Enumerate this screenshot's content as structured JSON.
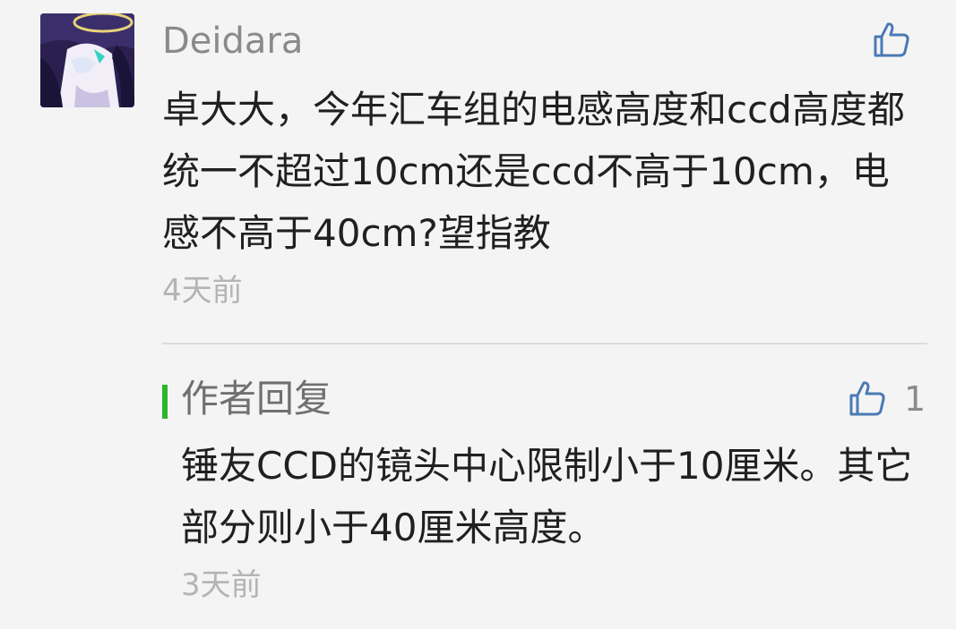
{
  "comment": {
    "username": "Deidara",
    "text": "卓大大，今年汇车组的电感高度和ccd高度都统一不超过10cm还是ccd不高于10cm，电感不高于40cm?望指教",
    "time": "4天前",
    "like_icon": "thumbs-up-icon",
    "avatar_icon": "anime-avatar"
  },
  "reply": {
    "label": "作者回复",
    "like_count": "1",
    "text": "锤友CCD的镜头中心限制小于10厘米。其它部分则小于40厘米高度。",
    "time": "3天前",
    "like_icon": "thumbs-up-icon"
  },
  "colors": {
    "accent_bar": "#2bb52b",
    "like_icon": "#4a7ab5",
    "background": "#f4f4f4"
  }
}
